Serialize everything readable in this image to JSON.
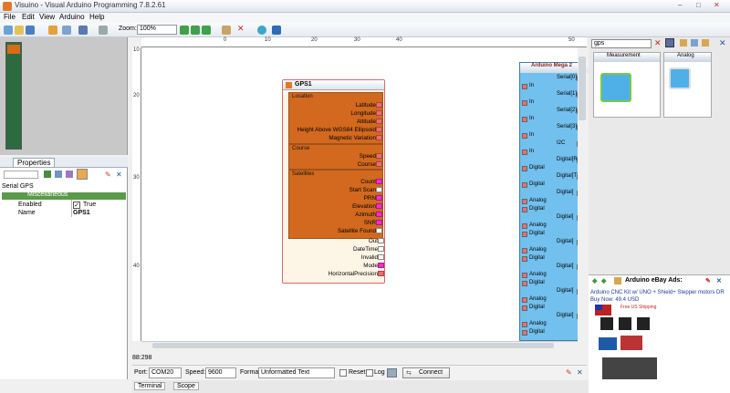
{
  "window": {
    "title": "Visuino - Visual Arduino Programming 7.8.2.61"
  },
  "menu": [
    "File",
    "Edit",
    "View",
    "Arduino",
    "Help"
  ],
  "toolbar": {
    "zoom_label": "Zoom:",
    "zoom_value": "100%"
  },
  "ruler": {
    "h": [
      "0",
      "10",
      "20",
      "30",
      "40",
      "50"
    ],
    "v": [
      "10",
      "20",
      "30",
      "40"
    ]
  },
  "properties": {
    "tab": "Properties",
    "object": "Serial GPS",
    "category": "Miscellaneous",
    "rows": [
      {
        "name": "Enabled",
        "value": "True"
      },
      {
        "name": "Name",
        "value": "GPS1"
      }
    ]
  },
  "gps": {
    "title": "GPS1",
    "location_label": "Location",
    "location": [
      "Latitude",
      "Longitude",
      "Altitude",
      "Height Above WGS84 Ellipsoid",
      "Magnetic Variation"
    ],
    "course_label": "Course",
    "course": [
      "Speed",
      "Course"
    ],
    "satellites_label": "Satellites",
    "satellites": [
      "Count",
      "Start Scan",
      "PRN",
      "Elevation",
      "Azimuth",
      "SNR",
      "Satellite Found"
    ],
    "outputs": [
      "Out",
      "DateTime",
      "Invalid",
      "Mode",
      "HorizontalPrecision"
    ]
  },
  "arduino": {
    "title": "Arduino Mega 2",
    "labels": [
      "Serial[0]",
      "In",
      "Serial[1]",
      "In",
      "Serial[2]",
      "In",
      "Serial[3]",
      "In",
      "I2C",
      "In",
      "Digital[RX]",
      "Digital",
      "Digital[TX]",
      "Digital",
      "Digital[",
      "Analog",
      "Digital",
      "Digital[",
      "Analog",
      "Digital",
      "Digital[",
      "Analog",
      "Digital",
      "Digital[",
      "Analog",
      "Digital",
      "Digital[",
      "Analog",
      "Digital",
      "Digital[",
      "Analog",
      "Digital"
    ]
  },
  "status": {
    "coords": "88:298"
  },
  "bottom": {
    "port_label": "Port:",
    "port": "COM20",
    "speed_label": "Speed:",
    "speed": "9600",
    "format_label": "Format:",
    "format": "Unformatted Text",
    "reset": "Reset",
    "log": "Log",
    "connect": "Connect"
  },
  "bottom_tabs": [
    "Terminal",
    "Scope"
  ],
  "search": {
    "value": "gps"
  },
  "palette": {
    "cat1": "Measurement",
    "cat2": "Analog"
  },
  "ebay": {
    "title": "Arduino eBay Ads:",
    "link": "Arduino CNC Kit w/ UNO + Shield+ Stepper motors DR",
    "price": "Buy Now: 49.4 USD",
    "badge": "Free US Shipping"
  }
}
